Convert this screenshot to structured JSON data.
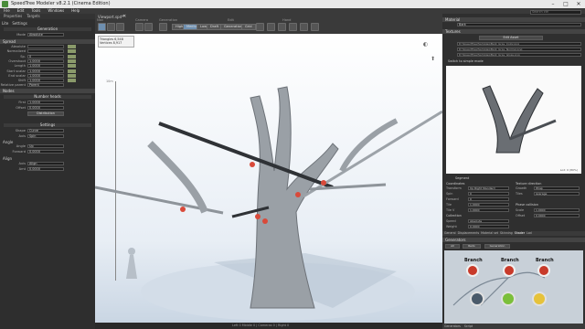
{
  "app": {
    "title": "SpeedTree Modeler v8.2.1 (Cinema Edition)"
  },
  "menu": [
    "File",
    "Edit",
    "Tools",
    "Windows",
    "Help"
  ],
  "left_panel": {
    "tabs": [
      "Properties",
      "Targets"
    ],
    "sub_tabs": [
      "Lite",
      "Settings"
    ],
    "generation_label": "Generation",
    "mode_label": "Mode",
    "mode_value": "Absolute",
    "spread_label": "Spread",
    "spread_rows": [
      {
        "label": "Absolute",
        "value": ""
      },
      {
        "label": "Normalized",
        "value": ""
      },
      {
        "label": "Sp.",
        "value": "0"
      },
      {
        "label": "Overshoot",
        "value": "1.0000"
      },
      {
        "label": "Length",
        "value": "1.0000"
      },
      {
        "label": "Start scalar",
        "value": "1.0000"
      },
      {
        "label": "End scalar",
        "value": "1.0000"
      },
      {
        "label": "Shift",
        "value": "1.0000"
      },
      {
        "label": "Relative parent",
        "value": "Parent"
      }
    ],
    "nodes_header": "Nodes",
    "number_heads": "Number heads",
    "first_label": "First",
    "first_value": "1.0000",
    "offset_label": "Offset",
    "offset_value": "0.0000",
    "distribution_button": "Distribution",
    "settings_label": "Settings",
    "angle_rows": [
      {
        "label": "Shape",
        "value": "Curve"
      },
      {
        "label": "Axis",
        "value": "Spin"
      },
      {
        "label": "Angle",
        "value": "Up"
      },
      {
        "label": "Forward",
        "value": "0.0000"
      }
    ],
    "angle_header": "Angle",
    "align_header": "Align",
    "align_rows": [
      {
        "label": "Axis",
        "value": "Align"
      },
      {
        "label": "Amt",
        "value": "0.0000"
      }
    ]
  },
  "toolbar": {
    "groups": [
      "Nav",
      "Camera",
      "Generation",
      "Edit",
      "Hand"
    ],
    "node_label": "Node",
    "mode_buttons": [
      "High",
      "Medium",
      "Low",
      "Draft"
    ],
    "generation_button": "Generation",
    "grid_button": "Grid"
  },
  "viewport": {
    "tab": "Viewport.spd*",
    "info": [
      "Triangles 6,548",
      "Vertices 8,917"
    ],
    "height_label": "10m",
    "bottom_status": "Left 0 Middle 0 | Cameras 0 | Right 0"
  },
  "right_panel": {
    "search_placeholder": "Search ctrl",
    "material_header": "Material",
    "material_value": "Bark",
    "textures_header": "Textures",
    "load_button": "Edit Asset",
    "texture_paths": [
      "D:\\SpeedTree\\Samples\\Bark_Gray_Color.png",
      "D:\\SpeedTree\\Samples\\Bark_Gray_Normal.png",
      "D:\\SpeedTree\\Samples\\Bark_Gray_Gloss.png"
    ],
    "switch_label": "Switch to simple mode",
    "preview_caption": "Lod: 0 (80%)",
    "uv_label": "Segment",
    "coordinates_header": "Coordinates",
    "transform_label": "Transform",
    "transform_value": "Up Right Standard",
    "spin_label": "Spin",
    "spin_value": "0",
    "forward_label": "Forward",
    "forward_value": "0",
    "tile_label": "Tile",
    "tile_value": "1.0000",
    "tile_v_label": "Tile V",
    "tile_v_value": "1.0000",
    "collection_label": "Collection",
    "speed_label": "Speed",
    "speed_value": "Absolute",
    "weight_label": "Weight",
    "weight_value": "0.0000",
    "extra_label": "Extra",
    "tex_direction_header": "Texture direction",
    "growth_label": "Growth",
    "growth_value": "Wrap",
    "tiles_label": "Tiles",
    "tiles_value": "Average",
    "phase_header": "Phase collision",
    "scale_label": "Scale",
    "scale_value": "1.0000",
    "offset_label": "Offset",
    "offset_value": "0.0000",
    "props_tabs": [
      "General",
      "Displacements",
      "Material set",
      "Skinning",
      "Shader",
      "Lod"
    ],
    "generators_header": "Generators",
    "gen_buttons": [
      "All",
      "Redo",
      "Generation"
    ],
    "nodes": [
      "Branch",
      "Branch",
      "Branch"
    ],
    "bottom_tabs": [
      "Generators",
      "Script"
    ]
  },
  "colors": {
    "accent": "#6e8fb0",
    "viewport_top": "#ffffff",
    "viewport_bottom": "#c7d4e2",
    "node_green": "#7bbf3a",
    "node_red": "#c83a2a"
  }
}
